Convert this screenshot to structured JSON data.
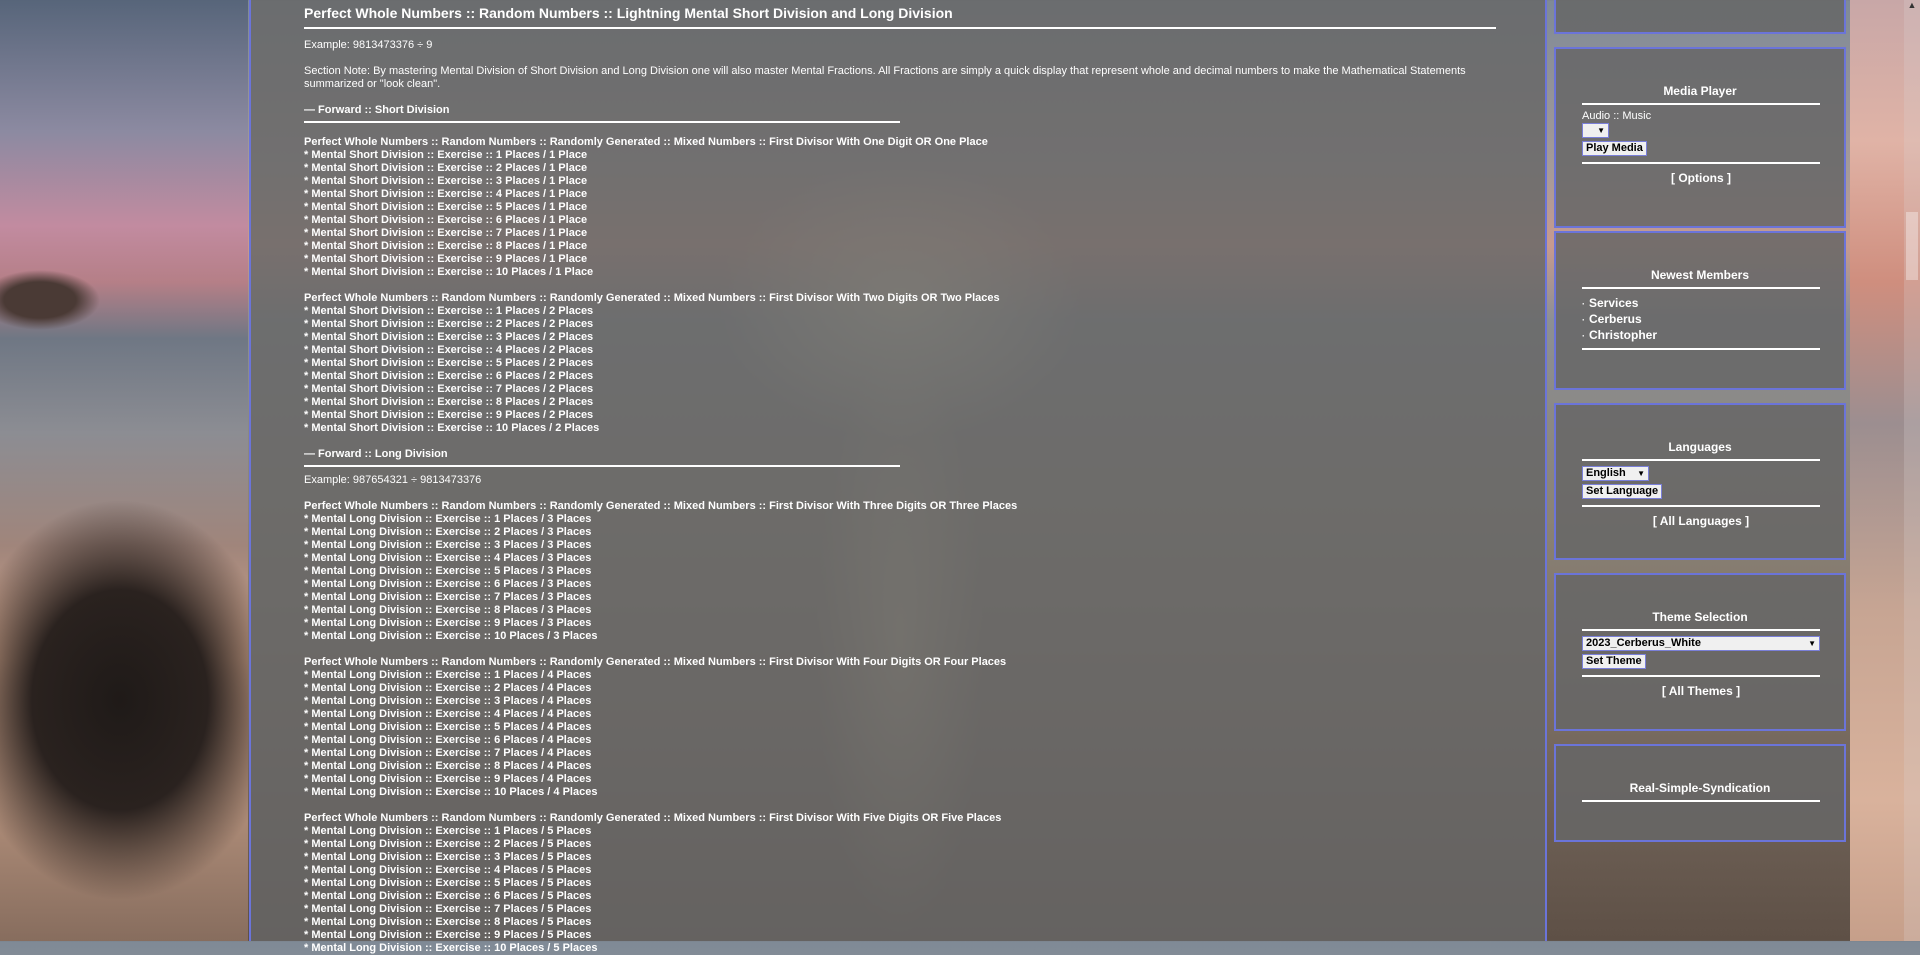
{
  "main": {
    "title": "Perfect Whole Numbers :: Random Numbers :: Lightning Mental Short Division and Long Division",
    "example1": "Example: 9813473376 ÷ 9",
    "section_note": "Section Note: By mastering Mental Division of Short Division and Long Division one will also master Mental Fractions. All Fractions are simply a quick display that represent whole and decimal numbers to make the Mathematical Statements summarized or \"look clean\".",
    "short_division_title": "— Forward :: Short Division",
    "long_division_title": "— Forward :: Long Division",
    "example2": "Example: 987654321 ÷ 9813473376",
    "short_blocks": [
      {
        "heading": "Perfect Whole Numbers :: Random Numbers :: Randomly Generated :: Mixed Numbers :: First Divisor With One Digit OR One Place",
        "items": [
          "* Mental Short Division :: Exercise :: 1 Places / 1 Place",
          "* Mental Short Division :: Exercise :: 2 Places / 1 Place",
          "* Mental Short Division :: Exercise :: 3 Places / 1 Place",
          "* Mental Short Division :: Exercise :: 4 Places / 1 Place",
          "* Mental Short Division :: Exercise :: 5 Places / 1 Place",
          "* Mental Short Division :: Exercise :: 6 Places / 1 Place",
          "* Mental Short Division :: Exercise :: 7 Places / 1 Place",
          "* Mental Short Division :: Exercise :: 8 Places / 1 Place",
          "* Mental Short Division :: Exercise :: 9 Places / 1 Place",
          "* Mental Short Division :: Exercise :: 10 Places / 1 Place"
        ]
      },
      {
        "heading": "Perfect Whole Numbers :: Random Numbers :: Randomly Generated :: Mixed Numbers :: First Divisor With Two Digits OR Two Places",
        "items": [
          "* Mental Short Division :: Exercise :: 1 Places / 2 Places",
          "* Mental Short Division :: Exercise :: 2 Places / 2 Places",
          "* Mental Short Division :: Exercise :: 3 Places / 2 Places",
          "* Mental Short Division :: Exercise :: 4 Places / 2 Places",
          "* Mental Short Division :: Exercise :: 5 Places / 2 Places",
          "* Mental Short Division :: Exercise :: 6 Places / 2 Places",
          "* Mental Short Division :: Exercise :: 7 Places / 2 Places",
          "* Mental Short Division :: Exercise :: 8 Places / 2 Places",
          "* Mental Short Division :: Exercise :: 9 Places / 2 Places",
          "* Mental Short Division :: Exercise :: 10 Places / 2 Places"
        ]
      }
    ],
    "long_blocks": [
      {
        "heading": "Perfect Whole Numbers :: Random Numbers :: Randomly Generated :: Mixed Numbers :: First Divisor With Three Digits OR Three Places",
        "items": [
          "* Mental Long Division :: Exercise :: 1 Places / 3 Places",
          "* Mental Long Division :: Exercise :: 2 Places / 3 Places",
          "* Mental Long Division :: Exercise :: 3 Places / 3 Places",
          "* Mental Long Division :: Exercise :: 4 Places / 3 Places",
          "* Mental Long Division :: Exercise :: 5 Places / 3 Places",
          "* Mental Long Division :: Exercise :: 6 Places / 3 Places",
          "* Mental Long Division :: Exercise :: 7 Places / 3 Places",
          "* Mental Long Division :: Exercise :: 8 Places / 3 Places",
          "* Mental Long Division :: Exercise :: 9 Places / 3 Places",
          "* Mental Long Division :: Exercise :: 10 Places / 3 Places"
        ]
      },
      {
        "heading": "Perfect Whole Numbers :: Random Numbers :: Randomly Generated :: Mixed Numbers :: First Divisor With Four Digits OR Four Places",
        "items": [
          "* Mental Long Division :: Exercise :: 1 Places / 4 Places",
          "* Mental Long Division :: Exercise :: 2 Places / 4 Places",
          "* Mental Long Division :: Exercise :: 3 Places / 4 Places",
          "* Mental Long Division :: Exercise :: 4 Places / 4 Places",
          "* Mental Long Division :: Exercise :: 5 Places / 4 Places",
          "* Mental Long Division :: Exercise :: 6 Places / 4 Places",
          "* Mental Long Division :: Exercise :: 7 Places / 4 Places",
          "* Mental Long Division :: Exercise :: 8 Places / 4 Places",
          "* Mental Long Division :: Exercise :: 9 Places / 4 Places",
          "* Mental Long Division :: Exercise :: 10 Places / 4 Places"
        ]
      },
      {
        "heading": "Perfect Whole Numbers :: Random Numbers :: Randomly Generated :: Mixed Numbers :: First Divisor With Five Digits OR Five Places",
        "items": [
          "* Mental Long Division :: Exercise :: 1 Places / 5 Places",
          "* Mental Long Division :: Exercise :: 2 Places / 5 Places",
          "* Mental Long Division :: Exercise :: 3 Places / 5 Places",
          "* Mental Long Division :: Exercise :: 4 Places / 5 Places",
          "* Mental Long Division :: Exercise :: 5 Places / 5 Places",
          "* Mental Long Division :: Exercise :: 6 Places / 5 Places",
          "* Mental Long Division :: Exercise :: 7 Places / 5 Places",
          "* Mental Long Division :: Exercise :: 8 Places / 5 Places",
          "* Mental Long Division :: Exercise :: 9 Places / 5 Places",
          "* Mental Long Division :: Exercise :: 10 Places / 5 Places"
        ]
      }
    ]
  },
  "sidebar": {
    "media_player": {
      "title": "Media Player",
      "audio_label": "Audio :: Music",
      "select_value": "",
      "play_button": "Play Media",
      "options_link": "[ Options ]"
    },
    "newest_members": {
      "title": "Newest Members",
      "members": [
        "Services",
        "Cerberus",
        "Christopher"
      ]
    },
    "languages": {
      "title": "Languages",
      "select_value": "English",
      "set_button": "Set Language",
      "all_link": "[ All Languages ]"
    },
    "theme": {
      "title": "Theme Selection",
      "select_value": "2023_Cerberus_White",
      "set_button": "Set Theme",
      "all_link": "[ All Themes ]"
    },
    "rss": {
      "title": "Real-Simple-Syndication"
    }
  },
  "colors": {
    "panel_border": "#6b74d9",
    "panel_bg": "#666666",
    "text": "#ffffff"
  }
}
